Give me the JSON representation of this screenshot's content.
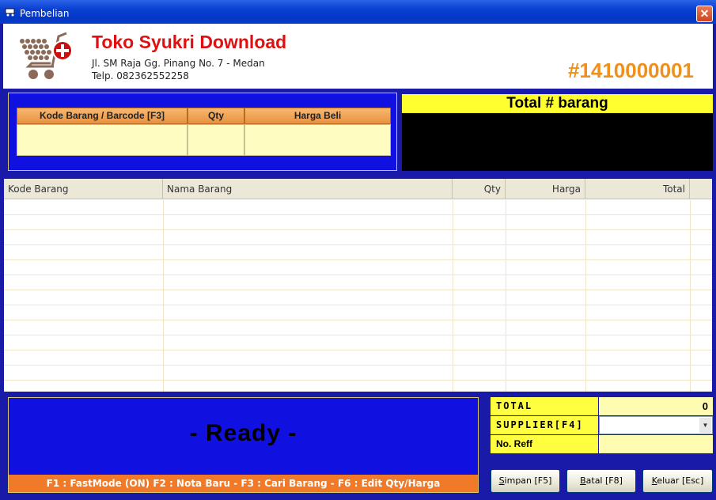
{
  "window": {
    "title": "Pembelian",
    "close_glyph": "✕"
  },
  "header": {
    "store_name": "Toko Syukri Download",
    "address": "Jl. SM Raja Gg. Pinang No. 7 - Medan",
    "phone": "Telp. 082362552258",
    "nota_number": "#1410000001",
    "logo_icon": "shopping-cart-add-icon"
  },
  "input": {
    "col_code": "Kode Barang / Barcode [F3]",
    "col_qty": "Qty",
    "col_price": "Harga Beli",
    "code_value": "",
    "qty_value": "",
    "price_value": ""
  },
  "total_items": {
    "label": "Total # barang"
  },
  "grid": {
    "headers": [
      "Kode Barang",
      "Nama Barang",
      "Qty",
      "Harga",
      "Total"
    ]
  },
  "status": {
    "text": "- Ready -",
    "hotkeys": "F1 : FastMode (ON) F2 : Nota Baru - F3 : Cari Barang - F6 : Edit Qty/Harga"
  },
  "summary": {
    "total_label": "TOTAL",
    "total_value": "0",
    "supplier_label": "SUPPLIER[F4]",
    "supplier_value": "",
    "reff_label": "No. Reff",
    "reff_value": ""
  },
  "buttons": {
    "save_u": "S",
    "save_rest": "impan [F5]",
    "cancel_u": "B",
    "cancel_rest": "atal [F8]",
    "exit_u": "K",
    "exit_rest": "eluar [Esc]"
  },
  "colors": {
    "accent": "#1010e0",
    "brand_red": "#e01010",
    "nota_orange": "#f0901c",
    "highlight_yellow": "#ffff30"
  }
}
